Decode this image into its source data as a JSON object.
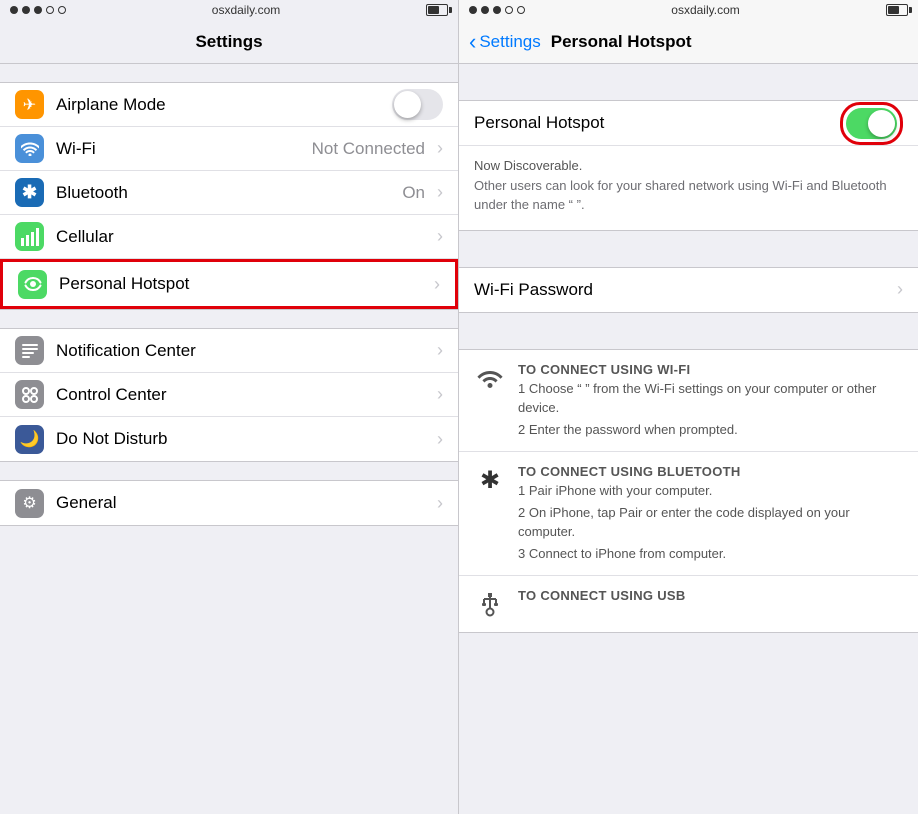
{
  "left": {
    "status": {
      "url": "osxdaily.com"
    },
    "title": "Settings",
    "rows": [
      {
        "id": "airplane",
        "label": "Airplane Mode",
        "icon_bg": "icon-orange",
        "icon_char": "✈",
        "type": "toggle",
        "value": "off"
      },
      {
        "id": "wifi",
        "label": "Wi-Fi",
        "icon_bg": "icon-blue",
        "icon_char": "📶",
        "type": "value",
        "value": "Not Connected"
      },
      {
        "id": "bluetooth",
        "label": "Bluetooth",
        "icon_bg": "icon-bluetooth",
        "icon_char": "✱",
        "type": "value",
        "value": "On"
      },
      {
        "id": "cellular",
        "label": "Cellular",
        "icon_bg": "icon-green-cellular",
        "icon_char": "📡",
        "type": "chevron",
        "value": ""
      },
      {
        "id": "hotspot",
        "label": "Personal Hotspot",
        "icon_bg": "icon-green-hotspot",
        "icon_char": "🔗",
        "type": "chevron",
        "value": "",
        "highlighted": true
      },
      {
        "id": "notification",
        "label": "Notification Center",
        "icon_bg": "icon-gray",
        "icon_char": "▤",
        "type": "chevron",
        "value": ""
      },
      {
        "id": "control",
        "label": "Control Center",
        "icon_bg": "icon-gray-cc",
        "icon_char": "⊞",
        "type": "chevron",
        "value": ""
      },
      {
        "id": "dnd",
        "label": "Do Not Disturb",
        "icon_bg": "icon-blue-dnd",
        "icon_char": "🌙",
        "type": "chevron",
        "value": ""
      },
      {
        "id": "general",
        "label": "General",
        "icon_bg": "icon-gray-general",
        "icon_char": "⚙",
        "type": "chevron",
        "value": ""
      }
    ]
  },
  "right": {
    "status": {
      "url": "osxdaily.com"
    },
    "back_label": "Settings",
    "title": "Personal Hotspot",
    "hotspot_label": "Personal Hotspot",
    "hotspot_toggle": "on",
    "discoverable_title": "Now Discoverable.",
    "discoverable_body": "Other users can look for your shared network using Wi-Fi and Bluetooth under the name “                ”.",
    "wifi_password_label": "Wi-Fi Password",
    "instructions": [
      {
        "id": "wifi",
        "icon": "wifi",
        "title": "TO CONNECT USING WI-FI",
        "steps": [
          "1 Choose “                ” from the Wi-Fi settings on your computer or other device.",
          "2 Enter the password when prompted."
        ]
      },
      {
        "id": "bluetooth",
        "icon": "bluetooth",
        "title": "TO CONNECT USING BLUETOOTH",
        "steps": [
          "1 Pair iPhone with your computer.",
          "2 On iPhone, tap Pair or enter the code displayed on your computer.",
          "3 Connect to iPhone from computer."
        ]
      },
      {
        "id": "usb",
        "icon": "usb",
        "title": "TO CONNECT USING USB",
        "steps": []
      }
    ]
  }
}
